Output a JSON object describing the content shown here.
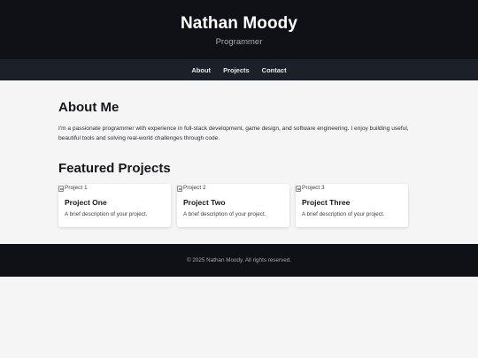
{
  "header": {
    "title": "Nathan Moody",
    "subtitle": "Programmer"
  },
  "nav": {
    "items": [
      {
        "label": "About"
      },
      {
        "label": "Projects"
      },
      {
        "label": "Contact"
      }
    ]
  },
  "about": {
    "heading": "About Me",
    "text": "I'm a passionate programmer with experience in full-stack development, game design, and software engineering. I enjoy building useful, beautiful tools and solving real-world challenges through code."
  },
  "projects": {
    "heading": "Featured Projects",
    "items": [
      {
        "image_alt": "Project 1",
        "title": "Project One",
        "description": "A brief description of your project."
      },
      {
        "image_alt": "Project 2",
        "title": "Project Two",
        "description": "A brief description of your project."
      },
      {
        "image_alt": "Project 3",
        "title": "Project Three",
        "description": "A brief description of your project."
      }
    ]
  },
  "footer": {
    "text": "© 2025 Nathan Moody. All rights reserved."
  },
  "colors": {
    "header_bg": "#0f1116",
    "nav_bg": "#1b2029",
    "page_bg": "#f5f5f5",
    "card_bg": "#ffffff"
  }
}
